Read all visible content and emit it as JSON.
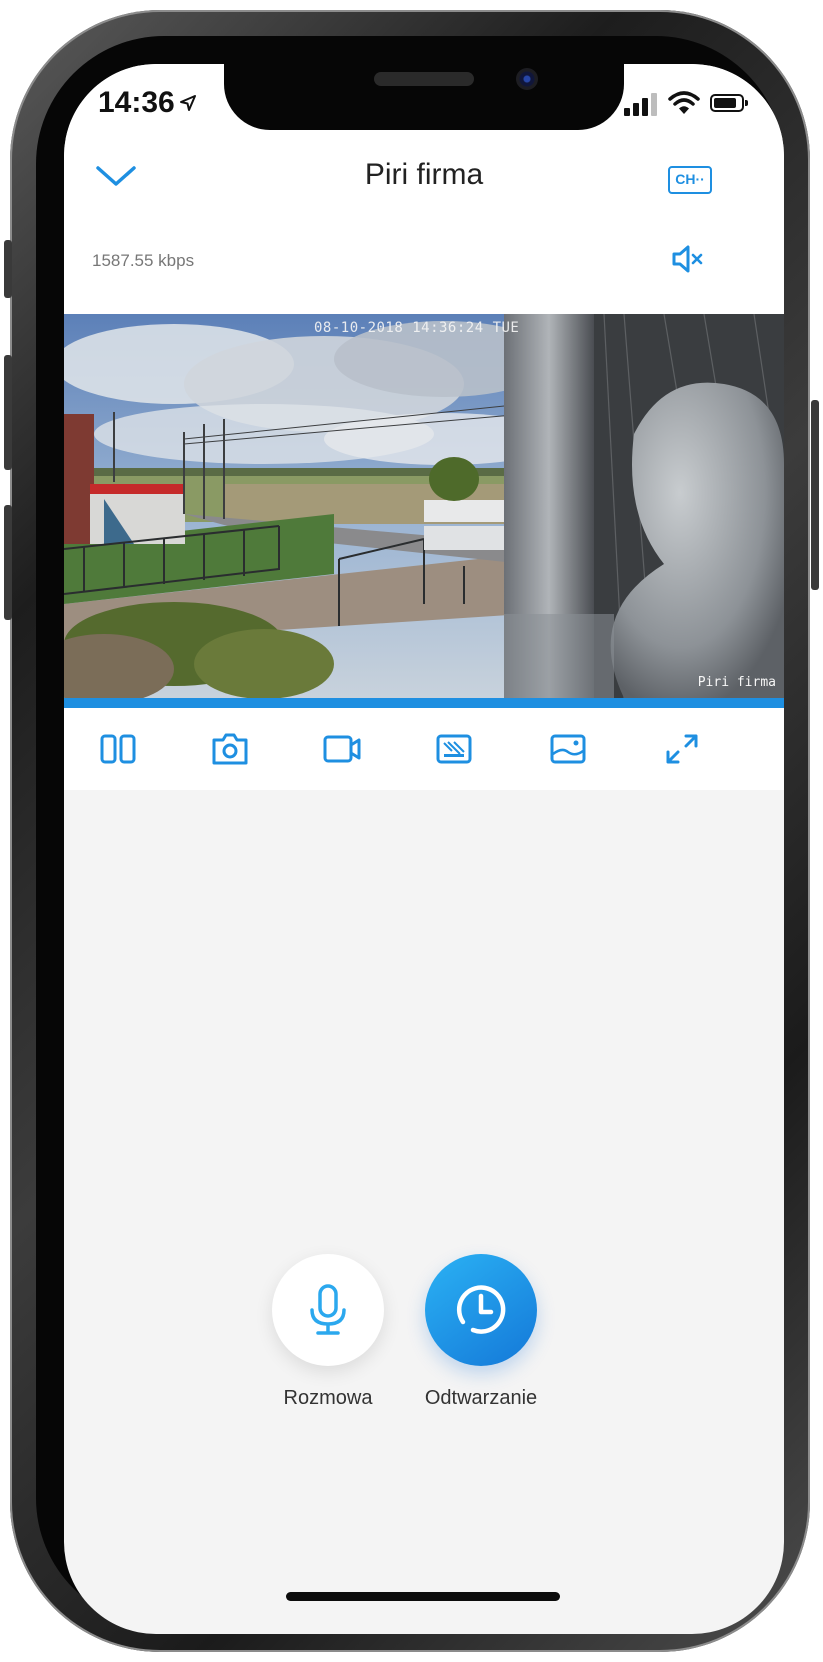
{
  "status_bar": {
    "time": "14:36",
    "location_arrow": "location-arrow-icon",
    "signal": "cellular-signal-icon",
    "wifi": "wifi-icon",
    "battery": "battery-icon"
  },
  "header": {
    "title": "Piri firma",
    "back_icon": "chevron-down-icon",
    "channel_label": "CH··"
  },
  "stream": {
    "bitrate": "1587.55 kbps",
    "mute_icon": "speaker-muted-icon"
  },
  "video": {
    "timestamp_overlay": "08-10-2018 14:36:24 TUE",
    "name_overlay": "Piri firma",
    "progress_fraction": 1.0
  },
  "toolbar": {
    "items": [
      {
        "icon": "split-view-icon"
      },
      {
        "icon": "camera-snapshot-icon"
      },
      {
        "icon": "video-record-icon"
      },
      {
        "icon": "quality-hd-icon"
      },
      {
        "icon": "image-settings-icon"
      },
      {
        "icon": "fullscreen-expand-icon"
      }
    ]
  },
  "actions": {
    "talk_label": "Rozmowa",
    "playback_label": "Odtwarzanie"
  },
  "colors": {
    "accent": "#1e8fe1",
    "accent_light": "#2bb2f4"
  }
}
